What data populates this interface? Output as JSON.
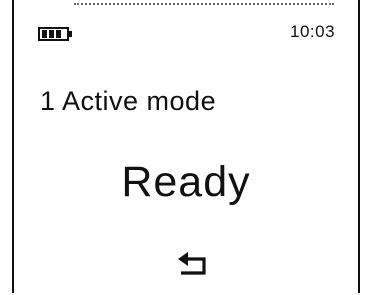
{
  "status": {
    "battery_icon": "battery-icon",
    "time": "10:03"
  },
  "screen": {
    "mode_label": "1 Active mode",
    "state_text": "Ready"
  },
  "controls": {
    "back_icon": "return-arrow-icon"
  }
}
